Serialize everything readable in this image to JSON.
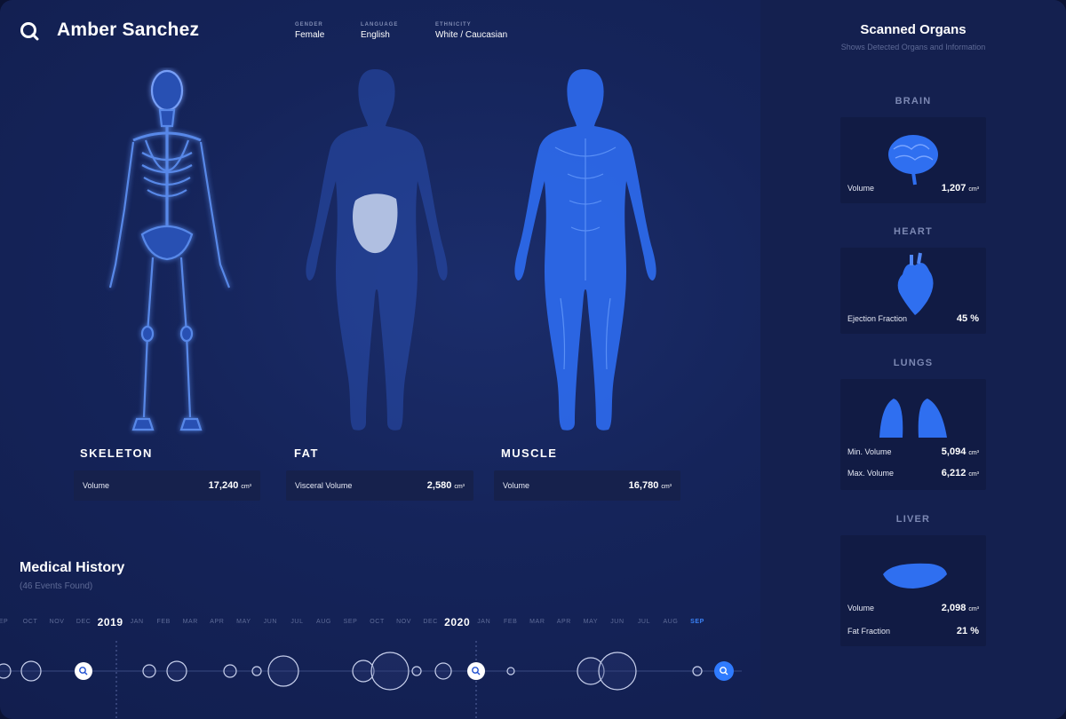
{
  "header": {
    "patient_name": "Amber Sanchez",
    "fields": [
      {
        "label": "GENDER",
        "value": "Female"
      },
      {
        "label": "LANGUAGE",
        "value": "English"
      },
      {
        "label": "ETHNICITY",
        "value": "White / Caucasian"
      }
    ]
  },
  "body_scans": [
    {
      "title": "SKELETON",
      "stat_label": "Volume",
      "stat_value": "17,240",
      "unit": "cm³"
    },
    {
      "title": "FAT",
      "stat_label": "Visceral Volume",
      "stat_value": "2,580",
      "unit": "cm³"
    },
    {
      "title": "MUSCLE",
      "stat_label": "Volume",
      "stat_value": "16,780",
      "unit": "cm³"
    }
  ],
  "medical_history": {
    "title": "Medical History",
    "subtitle": "(46 Events Found)",
    "months": [
      "EP",
      "OCT",
      "NOV",
      "DEC",
      "2019",
      "JAN",
      "FEB",
      "MAR",
      "APR",
      "MAY",
      "JUN",
      "JUL",
      "AUG",
      "SEP",
      "OCT",
      "NOV",
      "DEC",
      "2020",
      "JAN",
      "FEB",
      "MAR",
      "APR",
      "MAY",
      "JUN",
      "JUL",
      "AUG",
      "SEP"
    ],
    "current_month": "SEP"
  },
  "scanned_organs": {
    "title": "Scanned Organs",
    "subtitle": "Shows Detected Organs and Information",
    "organs": [
      {
        "name": "BRAIN",
        "rows": [
          {
            "label": "Volume",
            "value": "1,207",
            "unit": "cm³"
          }
        ]
      },
      {
        "name": "HEART",
        "rows": [
          {
            "label": "Ejection Fraction",
            "value": "45 %",
            "unit": ""
          }
        ]
      },
      {
        "name": "LUNGS",
        "rows": [
          {
            "label": "Min. Volume",
            "value": "5,094",
            "unit": "cm³"
          },
          {
            "label": "Max. Volume",
            "value": "6,212",
            "unit": "cm³"
          }
        ]
      },
      {
        "name": "LIVER",
        "rows": [
          {
            "label": "Volume",
            "value": "2,098",
            "unit": "cm³"
          },
          {
            "label": "Fat Fraction",
            "value": "21 %",
            "unit": ""
          }
        ]
      }
    ]
  },
  "colors": {
    "background": "#15245a",
    "panel": "#14204f",
    "accent": "#2f7bff",
    "card": "#16214c"
  }
}
